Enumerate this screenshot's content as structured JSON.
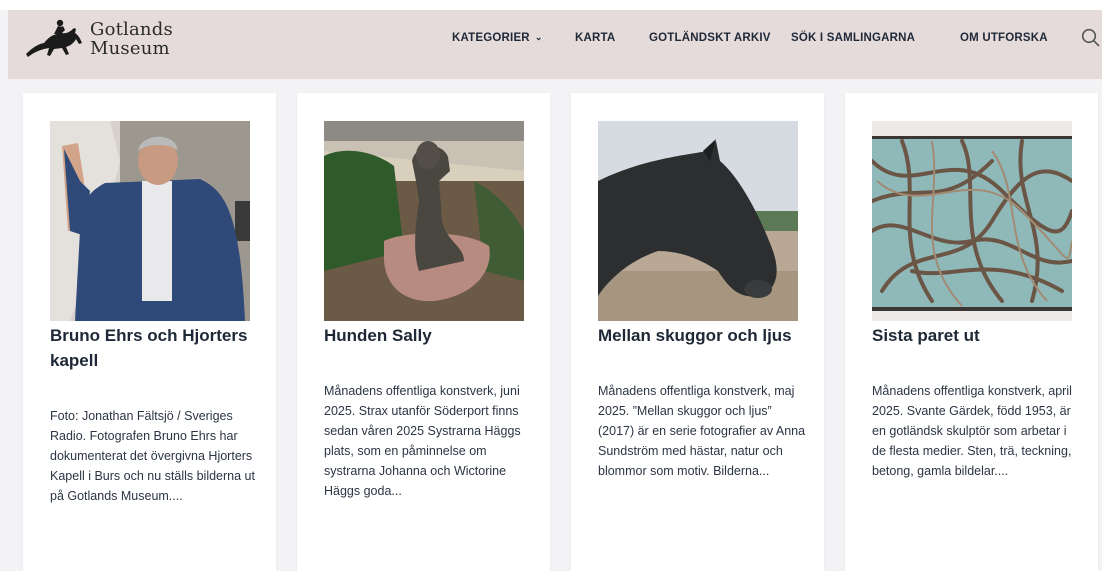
{
  "site": {
    "logo_line1": "Gotlands",
    "logo_line2": "Museum",
    "logo_icon": "horse-rider-icon"
  },
  "nav": {
    "items": [
      {
        "label": "KATEGORIER",
        "dropdown": true
      },
      {
        "label": "KARTA"
      },
      {
        "label": "GOTLÄNDSKT ARKIV"
      },
      {
        "label": "SÖK I SAMLINGARNA"
      },
      {
        "label": "OM UTFORSKA"
      }
    ],
    "search_icon": "search-icon"
  },
  "colors": {
    "header_bg": "#e6dbdb",
    "page_bg": "#f3f3f5",
    "card_bg": "#ffffff",
    "title": "#1e2837"
  },
  "cards": [
    {
      "title": "Bruno Ehrs och Hjorters kapell",
      "excerpt": "Foto: Jonathan Fältsjö / Sveriges Radio. Fotografen Bruno Ehrs har dokumenterat det övergivna Hjorters Kapell i Burs och nu ställs bilderna ut på Gotlands Museum...."
    },
    {
      "title": "Hunden Sally",
      "excerpt": "Månadens offentliga konstverk, juni 2025. Strax utanför Söderport finns sedan våren 2025 Systrarna Häggs plats, som en påminnelse om systrarna Johanna och Wictorine Häggs goda..."
    },
    {
      "title": "Mellan skuggor och ljus",
      "excerpt": "Månadens offentliga konstverk, maj 2025. ”Mellan skuggor och ljus” (2017) är en serie fotografier av Anna Sundström med hästar, natur och blommor som motiv.  Bilderna..."
    },
    {
      "title": "Sista paret ut",
      "excerpt": "Månadens offentliga konstverk, april 2025. Svante Gärdek, född 1953, är en gotländsk skulptör som arbetar i de flesta medier. Sten, trä, teckning, betong, gamla bildelar...."
    }
  ]
}
